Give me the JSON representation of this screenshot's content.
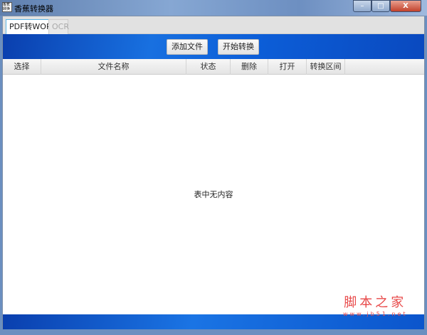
{
  "window": {
    "title": "香蕉转换器",
    "icon_text": "香蕉转换",
    "minimize": "–",
    "maximize": "□",
    "close": "X"
  },
  "tabs": [
    {
      "label": "PDF转WORD",
      "active": true
    },
    {
      "label": "OCR",
      "active": false
    }
  ],
  "toolbar": {
    "add_file": "添加文件",
    "start_convert": "开始转换"
  },
  "table": {
    "columns": [
      "选择",
      "文件名称",
      "状态",
      "删除",
      "打开",
      "转换区间"
    ],
    "empty_text": "表中无内容"
  },
  "watermark": {
    "line1": "脚本之家",
    "line2": "www.jb51.net"
  }
}
